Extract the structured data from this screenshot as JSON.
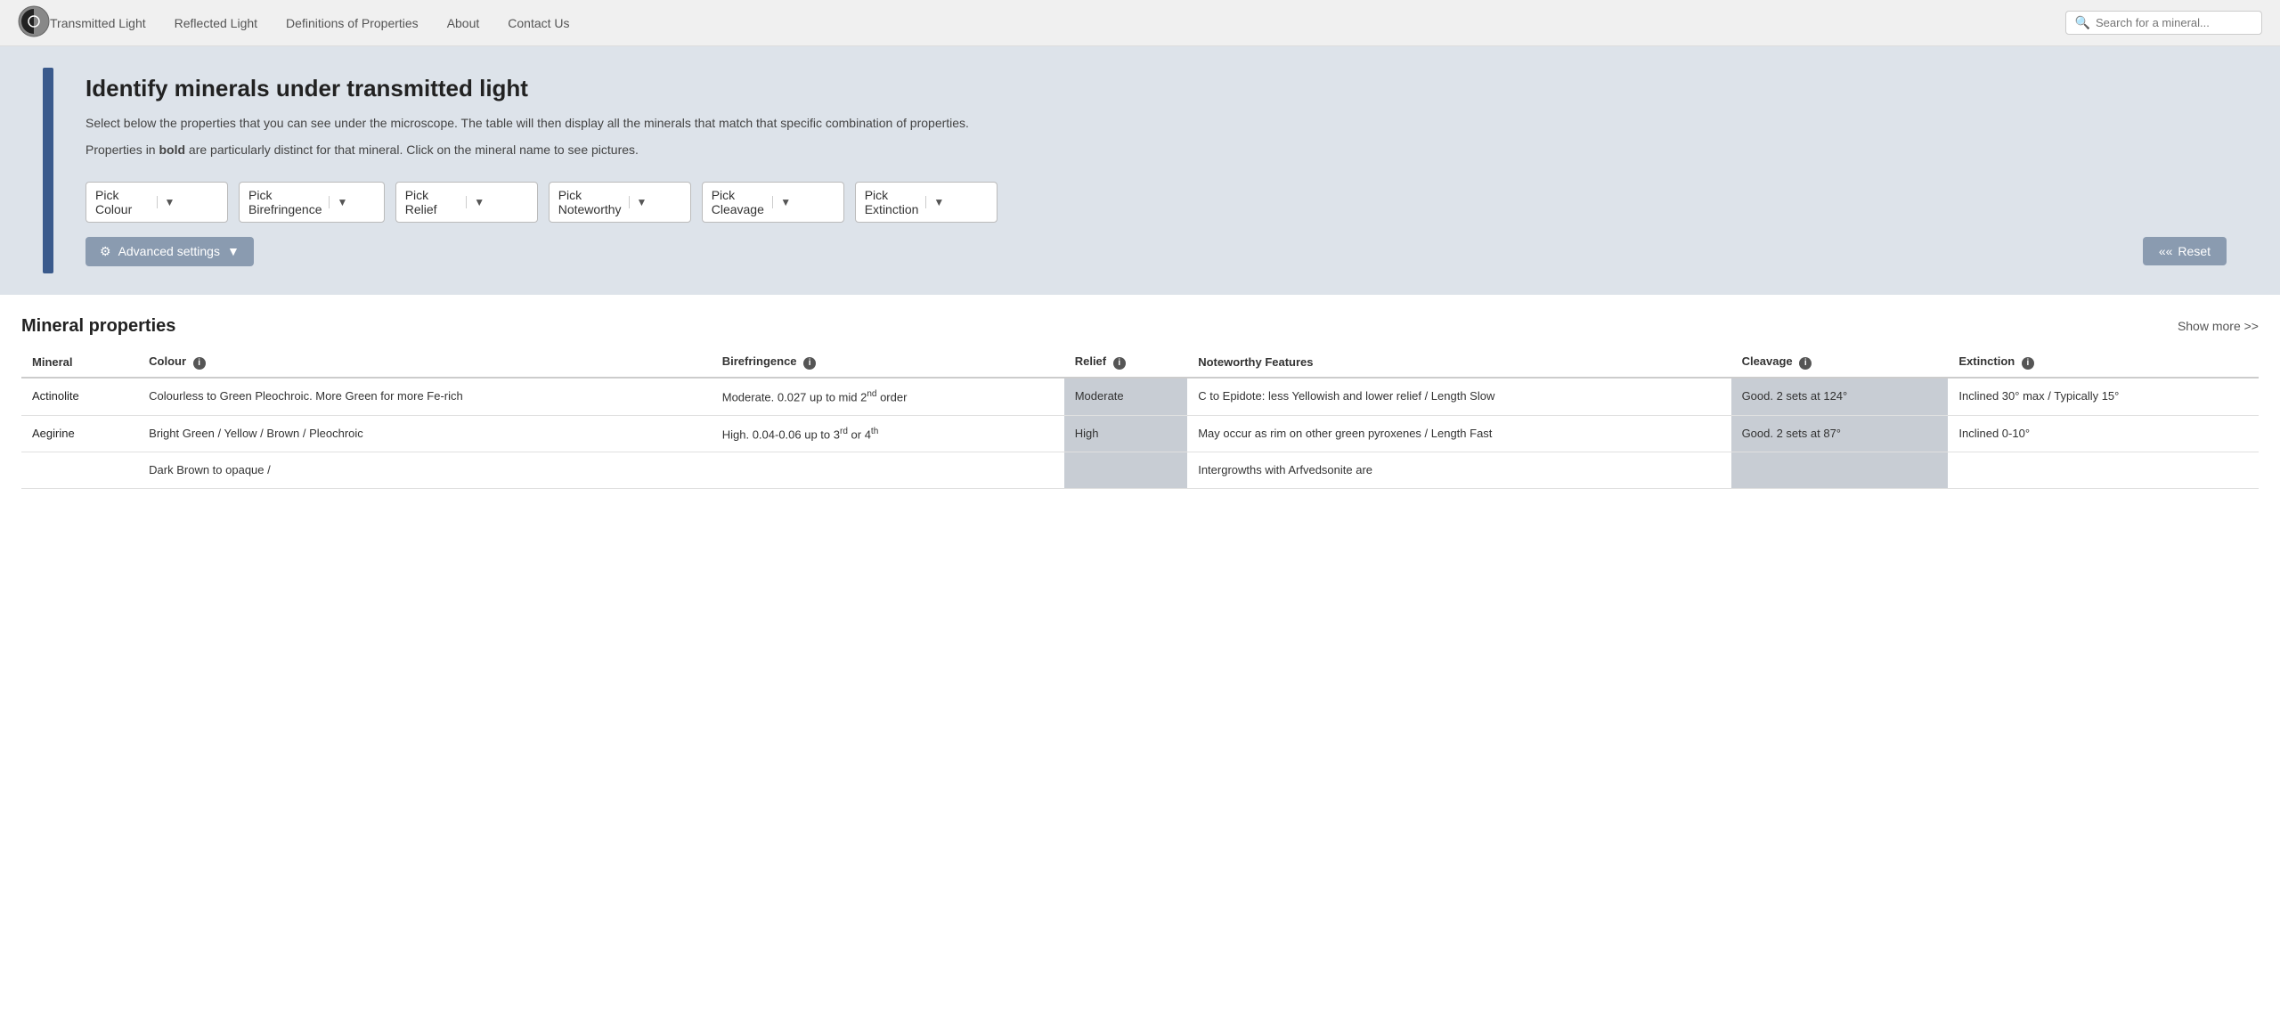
{
  "nav": {
    "links": [
      {
        "label": "Transmitted Light",
        "id": "transmitted-light"
      },
      {
        "label": "Reflected Light",
        "id": "reflected-light"
      },
      {
        "label": "Definitions of Properties",
        "id": "definitions"
      },
      {
        "label": "About",
        "id": "about"
      },
      {
        "label": "Contact Us",
        "id": "contact"
      }
    ],
    "search_placeholder": "Search for a mineral..."
  },
  "hero": {
    "title": "Identify minerals under transmitted light",
    "description": "Select below the properties that you can see under the microscope. The table will then display all the minerals that match that specific combination of properties.",
    "description2": "Properties in bold are particularly distinct for that mineral. Click on the mineral name to see pictures.",
    "bold_word": "bold"
  },
  "dropdowns": [
    {
      "id": "colour",
      "label": "Pick Colour"
    },
    {
      "id": "birefringence",
      "label": "Pick Birefringence"
    },
    {
      "id": "relief",
      "label": "Pick Relief"
    },
    {
      "id": "noteworthy",
      "label": "Pick Noteworthy"
    },
    {
      "id": "cleavage",
      "label": "Pick Cleavage"
    },
    {
      "id": "extinction",
      "label": "Pick Extinction"
    }
  ],
  "buttons": {
    "advanced": "Advanced settings",
    "reset": "Reset"
  },
  "table": {
    "section_title": "Mineral properties",
    "show_more": "Show more >>",
    "columns": [
      {
        "id": "mineral",
        "label": "Mineral"
      },
      {
        "id": "colour",
        "label": "Colour"
      },
      {
        "id": "birefringence",
        "label": "Birefringence"
      },
      {
        "id": "relief",
        "label": "Relief"
      },
      {
        "id": "noteworthy",
        "label": "Noteworthy Features"
      },
      {
        "id": "cleavage",
        "label": "Cleavage"
      },
      {
        "id": "extinction",
        "label": "Extinction"
      }
    ],
    "rows": [
      {
        "mineral": "Actinolite",
        "colour": "Colourless to Green Pleochroic. More Green for more Fe-rich",
        "birefringence": "Moderate. 0.027 up to mid 2nd order",
        "birefringence_sup": "nd",
        "relief": "Moderate",
        "noteworthy": "C to Epidote: less Yellowish and lower relief / Length Slow",
        "cleavage": "Good. 2 sets at 124°",
        "extinction": "Inclined 30° max / Typically 15°",
        "colour_shaded": false,
        "birefringence_shaded": false,
        "relief_shaded": true,
        "cleavage_shaded": true
      },
      {
        "mineral": "Aegirine",
        "colour": "Bright Green / Yellow / Brown / Pleochroic",
        "birefringence": "High. 0.04-0.06 up to 3rd or 4th",
        "birefringence_sup3": "rd",
        "birefringence_sup4": "th",
        "relief": "High",
        "noteworthy": "May occur as rim on other green pyroxenes / Length Fast",
        "cleavage": "Good. 2 sets at 87°",
        "extinction": "Inclined 0-10°",
        "colour_shaded": false,
        "birefringence_shaded": false,
        "relief_shaded": true,
        "cleavage_shaded": true
      },
      {
        "mineral": "...",
        "colour": "Dark Brown to opaque /",
        "birefringence": "",
        "relief": "",
        "noteworthy": "Intergrowths with Arfvedsonite are",
        "cleavage": "",
        "extinction": "",
        "partial": true
      }
    ]
  }
}
